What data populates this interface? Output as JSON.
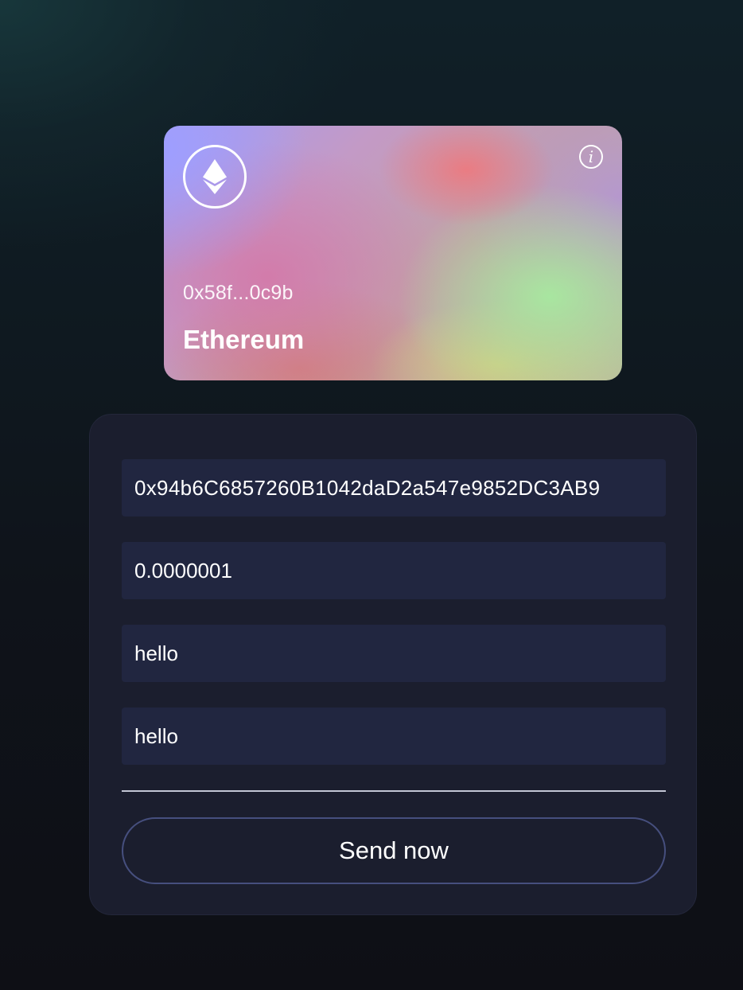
{
  "wallet_card": {
    "icon": "ethereum-icon",
    "info_icon": "info-icon",
    "info_glyph": "i",
    "address": "0x58f...0c9b",
    "network": "Ethereum"
  },
  "send_form": {
    "recipient": "0x94b6C6857260B1042daD2a547e9852DC3AB9",
    "amount": "0.0000001",
    "memo_1": "hello",
    "memo_2": "hello",
    "send_label": "Send now"
  },
  "colors": {
    "background": "#0f131a",
    "panel": "#1b1e2e",
    "field": "#212640",
    "button_border": "#464f7e"
  }
}
